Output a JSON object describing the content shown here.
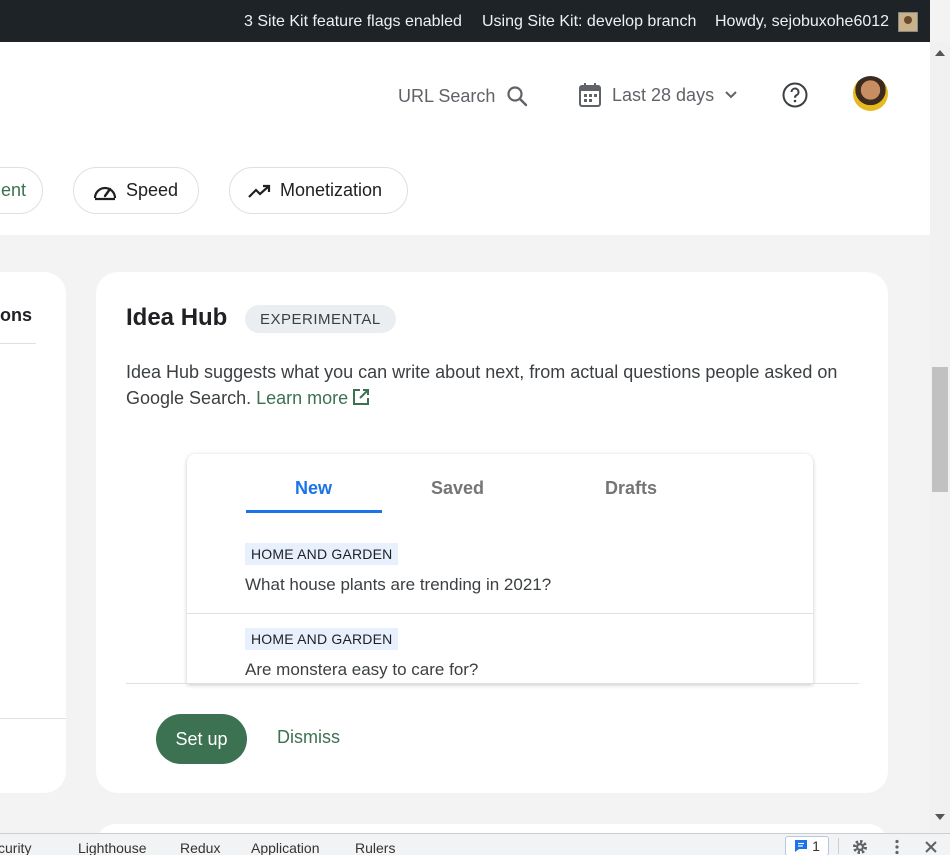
{
  "adminbar": {
    "feature_flags": "3 Site Kit feature flags enabled",
    "branch": "Using Site Kit: develop branch",
    "howdy": "Howdy, sejobuxohe6012"
  },
  "header": {
    "url_search_label": "URL Search",
    "date_range_label": "Last 28 days"
  },
  "nav_chips": [
    {
      "label": "ent",
      "icon": ""
    },
    {
      "label": "Speed",
      "icon": "speedometer-icon"
    },
    {
      "label": "Monetization",
      "icon": "trending-up-icon"
    }
  ],
  "left_card": {
    "title_fragment": "ons"
  },
  "idea_hub": {
    "title": "Idea Hub",
    "badge": "EXPERIMENTAL",
    "description": "Idea Hub suggests what you can write about next, from actual questions people asked on Google Search.",
    "learn_more": "Learn more",
    "tabs": [
      "New",
      "Saved",
      "Drafts"
    ],
    "active_tab": "New",
    "ideas": [
      {
        "topic": "HOME AND GARDEN",
        "question": "What house plants are trending in 2021?"
      },
      {
        "topic": "HOME AND GARDEN",
        "question": "Are monstera easy to care for?"
      }
    ],
    "setup_label": "Set up",
    "dismiss_label": "Dismiss"
  },
  "devtools": {
    "tabs": [
      "curity",
      "Lighthouse",
      "Redux",
      "Application",
      "Rulers"
    ],
    "issues_count": "1"
  },
  "colors": {
    "adminbar_bg": "#1d2327",
    "brand_green": "#3c7251",
    "tab_active_blue": "#1a73e8",
    "topic_tag_bg": "#e8f0fe"
  }
}
